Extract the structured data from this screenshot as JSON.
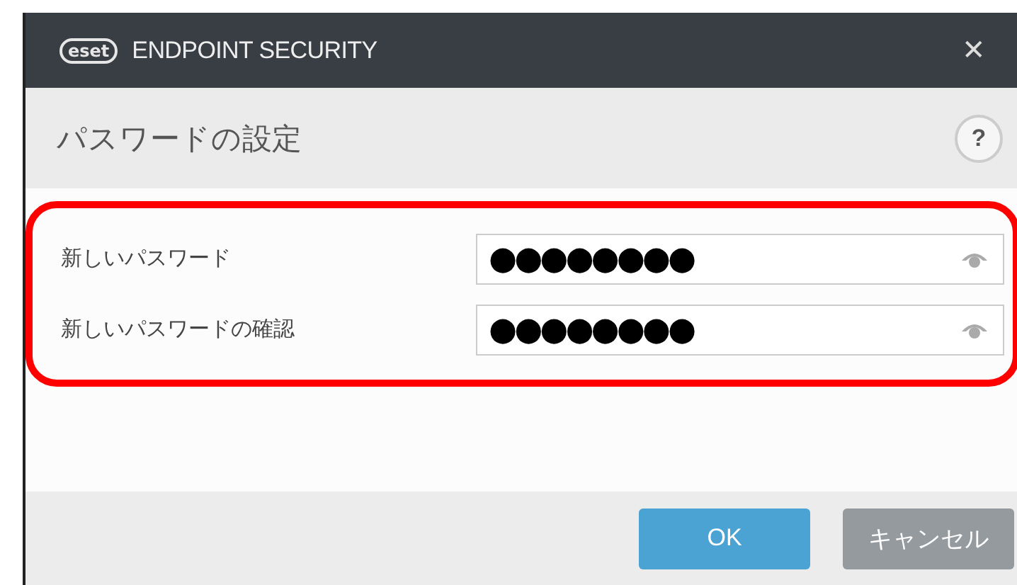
{
  "window": {
    "logo": "eset",
    "title": "ENDPOINT SECURITY",
    "close": "✕"
  },
  "header": {
    "title": "パスワードの設定",
    "help": "?"
  },
  "fields": [
    {
      "label": "新しいパスワード",
      "value": "●●●●●●●●"
    },
    {
      "label": "新しいパスワードの確認",
      "value": "●●●●●●●●"
    }
  ],
  "buttons": [
    {
      "label": "OK",
      "kind": "primary"
    },
    {
      "label": "キャンセル",
      "kind": "secondary"
    }
  ]
}
